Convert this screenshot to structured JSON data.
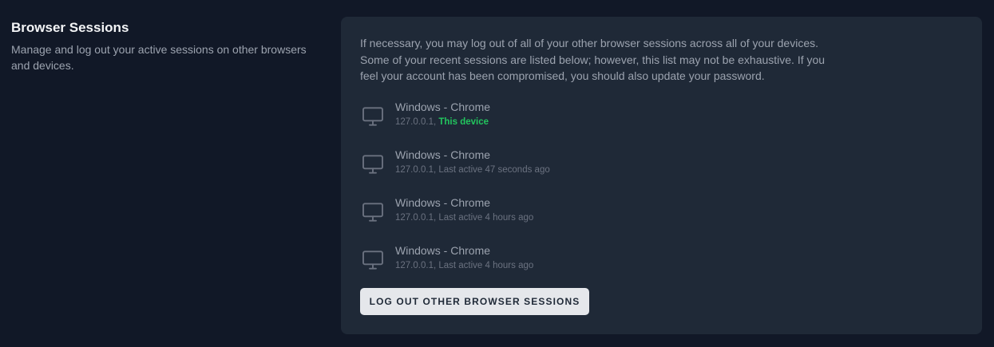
{
  "section": {
    "title": "Browser Sessions",
    "description": "Manage and log out your active sessions on other browsers and devices."
  },
  "card": {
    "intro": "If necessary, you may log out of all of your other browser sessions across all of your devices. Some of your recent sessions are listed below; however, this list may not be exhaustive. If you feel your account has been compromised, you should also update your password.",
    "sessions": [
      {
        "name": "Windows - Chrome",
        "ip": "127.0.0.1,",
        "status": "This device",
        "icon": "desktop-icon"
      },
      {
        "name": "Windows - Chrome",
        "ip": "127.0.0.1,",
        "status": "Last active 47 seconds ago",
        "icon": "desktop-icon"
      },
      {
        "name": "Windows - Chrome",
        "ip": "127.0.0.1,",
        "status": "Last active 4 hours ago",
        "icon": "desktop-icon"
      },
      {
        "name": "Windows - Chrome",
        "ip": "127.0.0.1,",
        "status": "Last active 4 hours ago",
        "icon": "desktop-icon"
      }
    ],
    "logout_button_label": "Log Out Other Browser Sessions"
  },
  "colors": {
    "page_background": "#111827",
    "card_background": "#1f2937",
    "this_device": "#22c55e",
    "button_background": "#e5e7eb"
  }
}
